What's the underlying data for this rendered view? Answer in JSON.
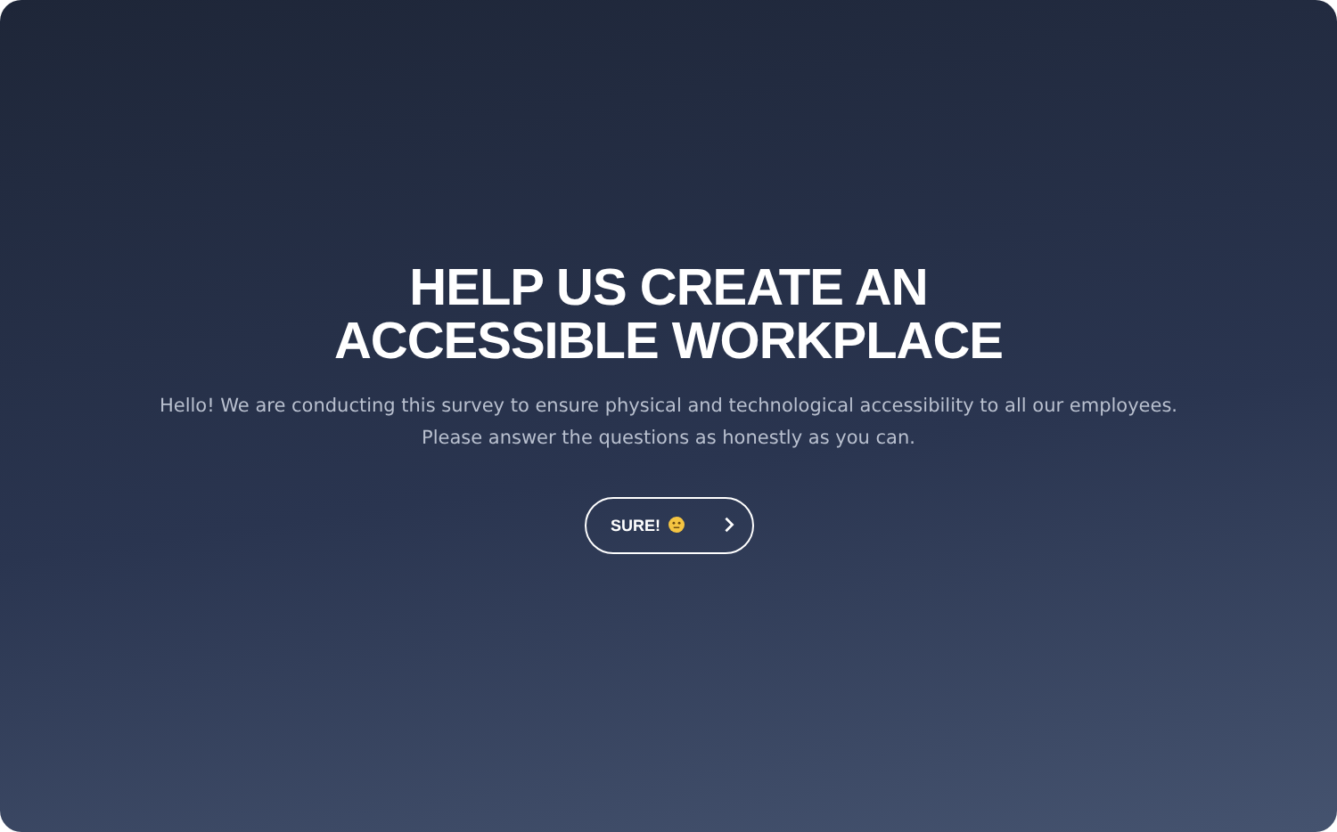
{
  "title": "HELP US CREATE AN ACCESSIBLE WORKPLACE",
  "intro": "Hello! We are conducting this survey to ensure physical and technological accessibility to all our employees. Please answer the questions as honestly as you can.",
  "start_button": {
    "label": "SURE!"
  }
}
